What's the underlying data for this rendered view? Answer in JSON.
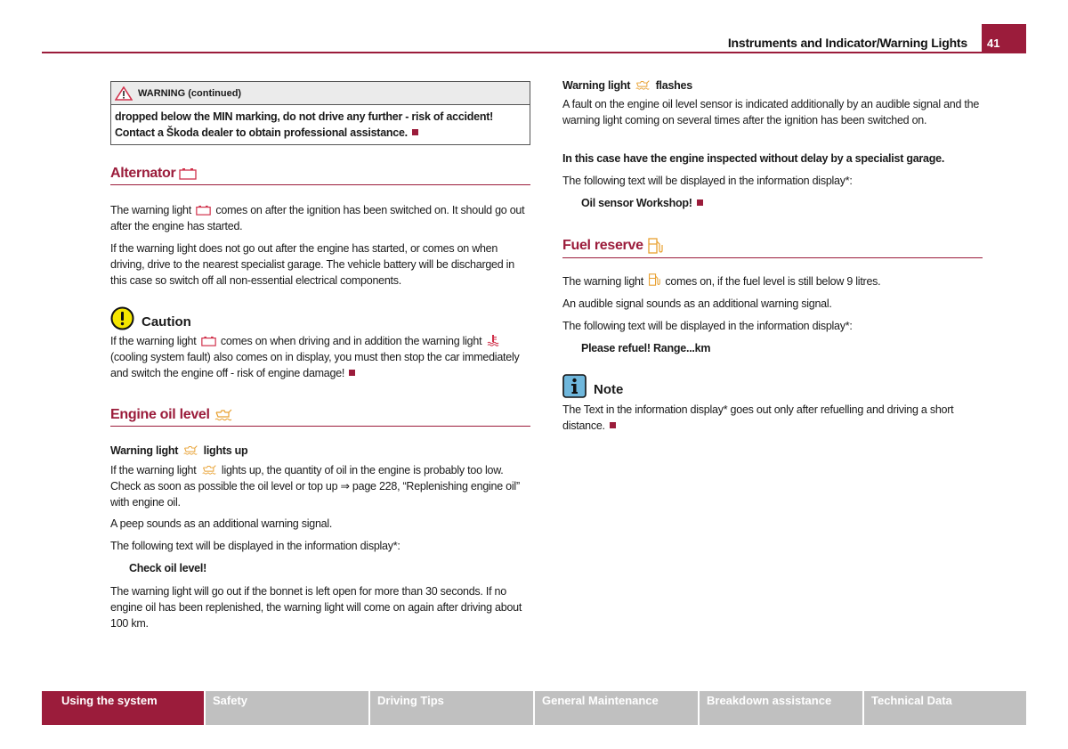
{
  "header": {
    "title": "Instruments and Indicator/Warning Lights",
    "page_number": "41"
  },
  "colors": {
    "accent": "#9b1c3b",
    "tab_inactive": "#c0c0c0",
    "icon_amber": "#e8a030",
    "caution_yellow": "#f5e600",
    "note_blue": "#6fb7dc"
  },
  "warning_box": {
    "icon": "warning-triangle-icon",
    "title": "WARNING (continued)",
    "line1": "dropped below the MIN marking, do not drive any further - risk of accident!",
    "line2": "Contact a Škoda dealer to obtain professional assistance."
  },
  "alternator": {
    "heading": "Alternator",
    "icon": "battery-icon",
    "p1_before": "The warning light",
    "p1_after": "comes on after the ignition has been switched on. It should go out after the engine has started.",
    "p2": "If the warning light does not go out after the engine has started, or comes on when driving, drive to the nearest specialist garage. The vehicle battery will be discharged in this case so switch off all non-essential electrical components."
  },
  "caution": {
    "title": "Caution",
    "icon": "exclamation-circle-icon",
    "text_before": "If the warning light",
    "text_middle": "comes on when driving and in addition the warning light",
    "text_after": "(cooling system fault) also comes on in display, you must then stop the car immediately and switch the engine off - risk of engine damage!"
  },
  "engine_oil": {
    "heading": "Engine oil level",
    "icon": "oil-can-icon",
    "sub1_before": "Warning light",
    "sub1_after": "lights up",
    "p1_before": "If the warning light",
    "p1_after": "lights up, the quantity of oil in the engine is probably too low. Check as soon as possible the oil level or top up ⇒ page 228, “Replenishing engine oil” with engine oil.",
    "p2": "A peep sounds as an additional warning signal.",
    "p3": "The following text will be displayed in the information display*:",
    "display_msg": "Check oil level!",
    "p4": "The warning light will go out if the bonnet is left open for more than 30 seconds. If no engine oil has been replenished, the warning light will come on again after driving about 100 km.",
    "sub2_before": "Warning light",
    "sub2_after": "flashes",
    "p5": "A fault on the engine oil level sensor is indicated additionally by an audible signal and the warning light coming on several times after the ignition has been switched on.",
    "p6": "In this case have the engine inspected without delay by a specialist garage.",
    "p7": "The following text will be displayed in the information display*:",
    "display_msg2": "Oil sensor Workshop!"
  },
  "fuel": {
    "heading": "Fuel reserve",
    "icon": "fuel-pump-icon",
    "p1_before": "The warning light",
    "p1_after": "comes on, if the fuel level is still below 9 litres.",
    "p2": "An audible signal sounds as an additional warning signal.",
    "p3": "The following text will be displayed in the information display*:",
    "display_msg": "Please refuel! Range...km"
  },
  "note": {
    "title": "Note",
    "icon": "info-icon",
    "text": "The Text in the information display* goes out only after refuelling and driving a short distance."
  },
  "footer_tabs": [
    {
      "label": "Using the system",
      "active": true
    },
    {
      "label": "Safety",
      "active": false
    },
    {
      "label": "Driving Tips",
      "active": false
    },
    {
      "label": "General Maintenance",
      "active": false
    },
    {
      "label": "Breakdown assistance",
      "active": false
    },
    {
      "label": "Technical Data",
      "active": false
    }
  ]
}
